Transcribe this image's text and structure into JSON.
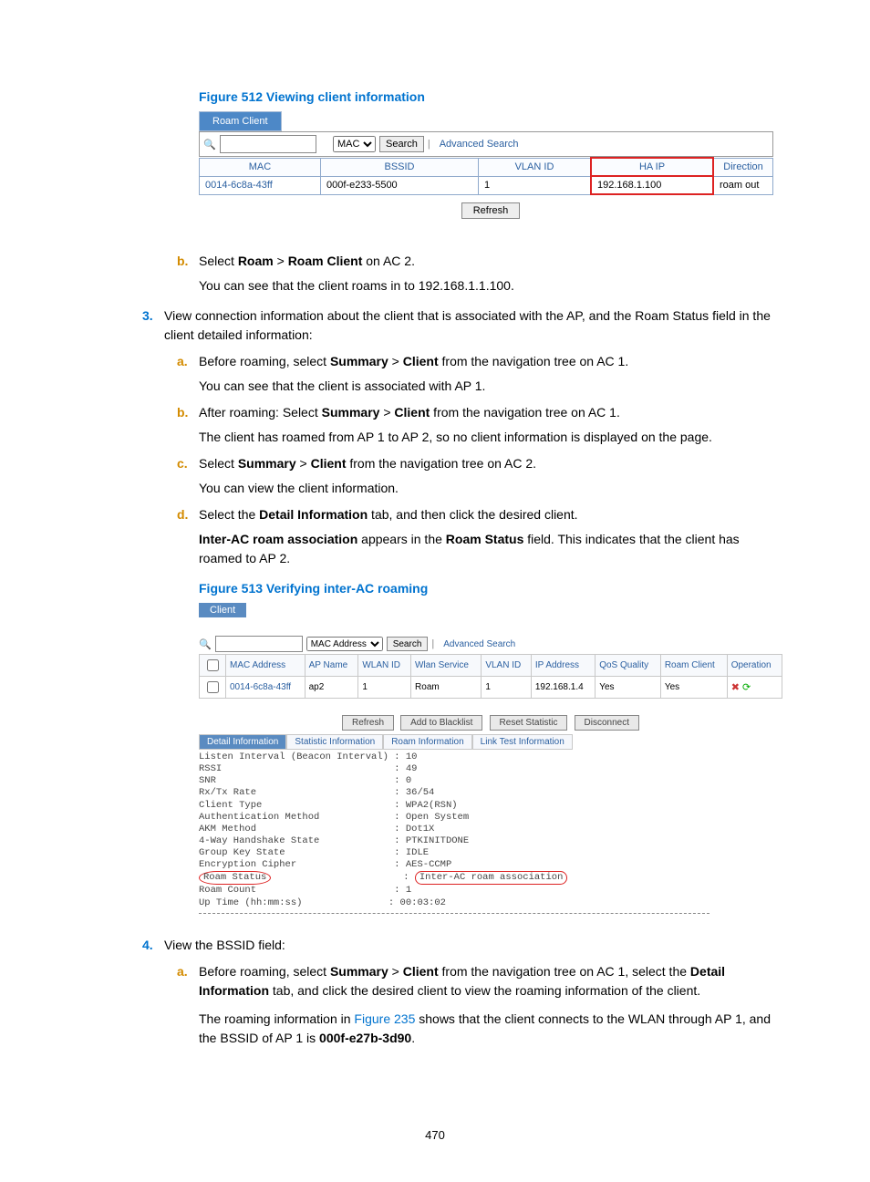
{
  "figure512": {
    "title": "Figure 512 Viewing client information",
    "tab": "Roam Client",
    "search_select": "MAC",
    "search_btn": "Search",
    "adv_search": "Advanced Search",
    "headers": [
      "MAC",
      "BSSID",
      "VLAN ID",
      "HA IP",
      "Direction"
    ],
    "row": [
      "0014-6c8a-43ff",
      "000f-e233-5500",
      "1",
      "192.168.1.100",
      "roam out"
    ],
    "refresh": "Refresh"
  },
  "step_b_before": {
    "letter": "b.",
    "line1_pre": "Select ",
    "line1_b1": "Roam",
    "line1_mid": " > ",
    "line1_b2": "Roam Client",
    "line1_post": " on AC 2.",
    "line2": "You can see that the client roams in to 192.168.1.1.100."
  },
  "step_3": {
    "num": "3.",
    "text": "View connection information about the client that is associated with the AP, and the Roam Status field in the client detailed information:",
    "a": {
      "letter": "a.",
      "l1_pre": "Before roaming, select ",
      "l1_b1": "Summary",
      "l1_mid": " > ",
      "l1_b2": "Client",
      "l1_post": " from the navigation tree on AC 1.",
      "l2": "You can see that the client is associated with AP 1."
    },
    "b": {
      "letter": "b.",
      "l1_pre": "After roaming: Select ",
      "l1_b1": "Summary",
      "l1_mid": " > ",
      "l1_b2": "Client",
      "l1_post": " from the navigation tree on AC 1.",
      "l2": "The client has roamed from AP 1 to AP 2, so no client information is displayed on the page."
    },
    "c": {
      "letter": "c.",
      "l1_pre": "Select ",
      "l1_b1": "Summary",
      "l1_mid": " > ",
      "l1_b2": "Client",
      "l1_post": " from the navigation tree on AC 2.",
      "l2": "You can view the client information."
    },
    "d": {
      "letter": "d.",
      "l1_pre": "Select the ",
      "l1_b1": "Detail Information",
      "l1_mid": " tab, and then click the desired client.",
      "l2_b1": "Inter-AC roam association",
      "l2_mid": " appears in the ",
      "l2_b2": "Roam Status",
      "l2_post": " field. This indicates that the client has roamed to AP 2."
    }
  },
  "figure513": {
    "title": "Figure 513 Verifying inter-AC roaming",
    "tab": "Client",
    "search_select": "MAC Address",
    "search_btn": "Search",
    "adv_search": "Advanced Search",
    "headers": [
      "",
      "MAC Address",
      "AP Name",
      "WLAN ID",
      "Wlan Service",
      "VLAN ID",
      "IP Address",
      "QoS Quality",
      "Roam Client",
      "Operation"
    ],
    "row": [
      "",
      "0014-6c8a-43ff",
      "ap2",
      "1",
      "Roam",
      "1",
      "192.168.1.4",
      "Yes",
      "Yes",
      ""
    ],
    "buttons": [
      "Refresh",
      "Add to Blacklist",
      "Reset Statistic",
      "Disconnect"
    ],
    "subtabs": [
      "Detail Information",
      "Statistic Information",
      "Roam Information",
      "Link Test Information"
    ],
    "detail": {
      "l1k": "Listen Interval (Beacon Interval)",
      "l1v": "10",
      "l2k": "RSSI",
      "l2v": "49",
      "l3k": "SNR",
      "l3v": "0",
      "l4k": "Rx/Tx Rate",
      "l4v": "36/54",
      "l5k": "Client Type",
      "l5v": "WPA2(RSN)",
      "l6k": "Authentication Method",
      "l6v": "Open System",
      "l7k": "AKM Method",
      "l7v": "Dot1X",
      "l8k": "4-Way Handshake State",
      "l8v": "PTKINITDONE",
      "l9k": "Group Key State",
      "l9v": "IDLE",
      "l10k": "Encryption Cipher",
      "l10v": "AES-CCMP",
      "l11k": "Roam Status",
      "l11v": "Inter-AC roam association",
      "l12k": "Roam Count",
      "l12v": "1",
      "l13k": "Up Time (hh:mm:ss)",
      "l13v": "00:03:02"
    }
  },
  "step_4": {
    "num": "4.",
    "text": "View the BSSID field:",
    "a": {
      "letter": "a.",
      "l1_pre": "Before roaming, select ",
      "l1_b1": "Summary",
      "l1_mid": " > ",
      "l1_b2": "Client",
      "l1_post": " from the navigation tree on AC 1, select the ",
      "l1_b3": "Detail Information",
      "l1_post2": " tab, and click the desired client to view the roaming information of the client.",
      "l2_pre": "The roaming information in ",
      "l2_link": "Figure 235",
      "l2_mid": " shows that the client connects to the WLAN through AP 1, and the BSSID of AP 1 is ",
      "l2_b": "000f-e27b-3d90",
      "l2_post": "."
    }
  },
  "page_number": "470"
}
